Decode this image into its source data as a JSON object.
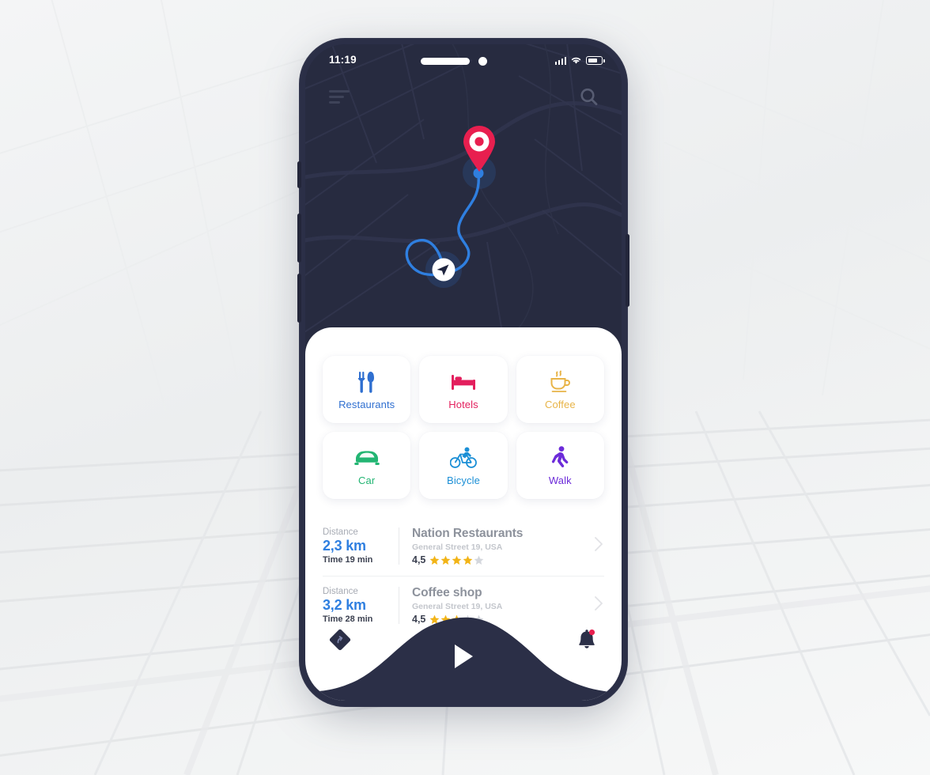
{
  "app": {
    "title": "Navigation Map App"
  },
  "status_bar": {
    "time": "11:19",
    "signal_icon": "signal-bars-icon",
    "wifi_icon": "wifi-icon",
    "battery_icon": "battery-icon"
  },
  "map_header": {
    "menu_icon": "hamburger-menu-icon",
    "search_icon": "search-icon"
  },
  "map": {
    "background_color": "#272b40",
    "route_color": "#2f7fe0",
    "destination_pin_color": "#e81f4f",
    "destination_pin_icon": "map-pin-icon",
    "user_location_icon": "navigation-arrow-icon"
  },
  "categories": [
    {
      "label": "Restaurants",
      "icon": "cutlery-icon",
      "color": "#2f6fd0"
    },
    {
      "label": "Hotels",
      "icon": "bed-icon",
      "color": "#e31f5d"
    },
    {
      "label": "Coffee",
      "icon": "coffee-cup-icon",
      "color": "#e8b448"
    },
    {
      "label": "Car",
      "icon": "car-icon",
      "color": "#23b573"
    },
    {
      "label": "Bicycle",
      "icon": "bicycle-icon",
      "color": "#1b8fd6"
    },
    {
      "label": "Walk",
      "icon": "walking-person-icon",
      "color": "#6c2bd9"
    }
  ],
  "places": [
    {
      "distance_label": "Distance",
      "distance_value": "2,3 km",
      "time": "Time 19 min",
      "name": "Nation Restaurants",
      "address": "General Street 19, USA",
      "rating": "4,5",
      "stars_filled": 4,
      "stars_total": 5,
      "chevron_icon": "chevron-right-icon"
    },
    {
      "distance_label": "Distance",
      "distance_value": "3,2 km",
      "time": "Time 28 min",
      "name": "Coffee shop",
      "address": "General Street 19, USA",
      "rating": "4,5",
      "stars_filled": 3,
      "stars_total": 5,
      "chevron_icon": "chevron-right-icon"
    }
  ],
  "bottom_nav": {
    "route_icon": "route-diamond-icon",
    "play_icon": "play-triangle-icon",
    "bell_icon": "bell-notification-icon",
    "bell_badge_color": "#e81f4f",
    "bar_color": "#2b2f47"
  },
  "theme": {
    "accent_blue": "#2f7fe0",
    "accent_pink": "#e81f4f",
    "star_gold": "#f2b417",
    "star_empty": "#d4d7dd",
    "sheet_bg": "#ffffff",
    "page_bg": "#f2f3f4"
  }
}
